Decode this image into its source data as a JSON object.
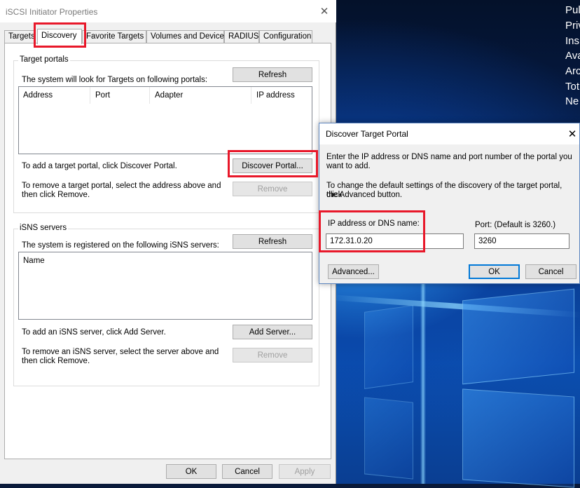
{
  "main_dialog": {
    "title": "iSCSI Initiator Properties",
    "tabs": [
      {
        "label": "Targets"
      },
      {
        "label": "Discovery"
      },
      {
        "label": "Favorite Targets"
      },
      {
        "label": "Volumes and Devices"
      },
      {
        "label": "RADIUS"
      },
      {
        "label": "Configuration"
      }
    ],
    "active_tab": "Discovery",
    "target_portals": {
      "legend": "Target portals",
      "description": "The system will look for Targets on following portals:",
      "refresh_label": "Refresh",
      "columns": [
        "Address",
        "Port",
        "Adapter",
        "IP address"
      ],
      "add_hint": "To add a target portal, click Discover Portal.",
      "discover_label": "Discover Portal...",
      "remove_hint_line1": "To remove a target portal, select the address above and",
      "remove_hint_line2": "then click Remove.",
      "remove_label": "Remove"
    },
    "isns_servers": {
      "legend": "iSNS servers",
      "description": "The system is registered on the following iSNS servers:",
      "refresh_label": "Refresh",
      "columns": [
        "Name"
      ],
      "add_hint": "To add an iSNS server, click Add Server.",
      "add_label": "Add Server...",
      "remove_hint_line1": "To remove an iSNS server, select the server above and",
      "remove_hint_line2": "then click Remove.",
      "remove_label": "Remove"
    },
    "footer": {
      "ok_label": "OK",
      "cancel_label": "Cancel",
      "apply_label": "Apply"
    }
  },
  "portal_dialog": {
    "title": "Discover Target Portal",
    "intro_line1": "Enter the IP address or DNS name and port number of the portal you",
    "intro_line2": "want to add.",
    "advanced_line1": "To change the default settings of the discovery of the target portal, click",
    "advanced_line2": "the Advanced button.",
    "ip_label": "IP address or DNS name:",
    "ip_value": "172.31.0.20",
    "port_label": "Port: (Default is 3260.)",
    "port_value": "3260",
    "advanced_label": "Advanced...",
    "ok_label": "OK",
    "cancel_label": "Cancel"
  },
  "desktop_text": [
    "Pul",
    "Priv",
    "Ins",
    "Ava",
    "Arc",
    "Tot",
    "Ne"
  ],
  "colors": {
    "highlight": "#e8182a",
    "focus": "#0078d7"
  }
}
